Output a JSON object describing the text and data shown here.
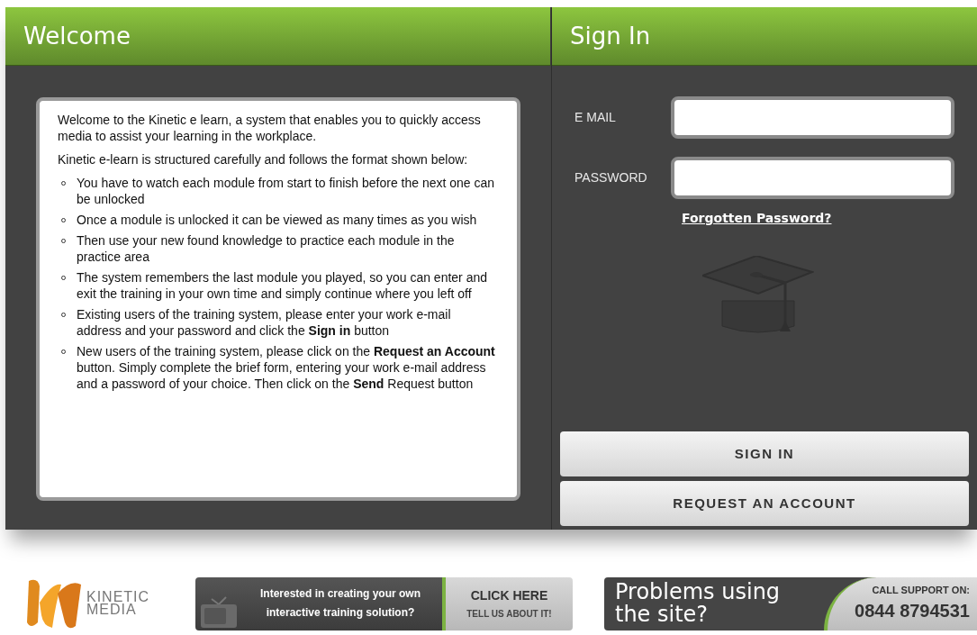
{
  "welcome": {
    "title": "Welcome",
    "paragraphs": [
      "Welcome to the Kinetic e learn, a system that enables you to quickly access media to assist your learning in the workplace.",
      "Kinetic e-learn is structured carefully and follows the format shown below:"
    ],
    "bullets": [
      "You have to watch each module from start to finish before the next one can be unlocked",
      "Once a module is unlocked it can be viewed as many times as you wish",
      "Then use your new found knowledge to practice each module in the practice area",
      "The system remembers the last module you played, so you can enter and exit the training in your own time and simply continue where you left off",
      "Existing users of the training system, please enter your work e-mail address and your password and click the **Sign in** button",
      "New users of the training system, please click on the **Request an Account** button. Simply complete the brief form, entering your work e-mail address and a password of your choice. Then click on the **Send** Request button"
    ]
  },
  "sign_in": {
    "title": "Sign In",
    "fields": [
      {
        "label": "E MAIL"
      },
      {
        "label": "PASSWORD"
      }
    ],
    "forgot_link": "Forgotten Password?",
    "buttons": [
      "SIGN IN",
      "REQUEST AN ACCOUNT"
    ]
  },
  "footer": {
    "logo": [
      "KINETIC",
      "MEDIA"
    ],
    "promo": {
      "text": "Interested in creating your own interactive training solution?",
      "cta": "CLICK HERE",
      "cta_sub": "TELL US ABOUT IT!"
    },
    "support": {
      "headline": [
        "Problems using",
        "the site?"
      ],
      "label": "CALL SUPPORT ON:",
      "phone": "0844 8794531"
    }
  }
}
